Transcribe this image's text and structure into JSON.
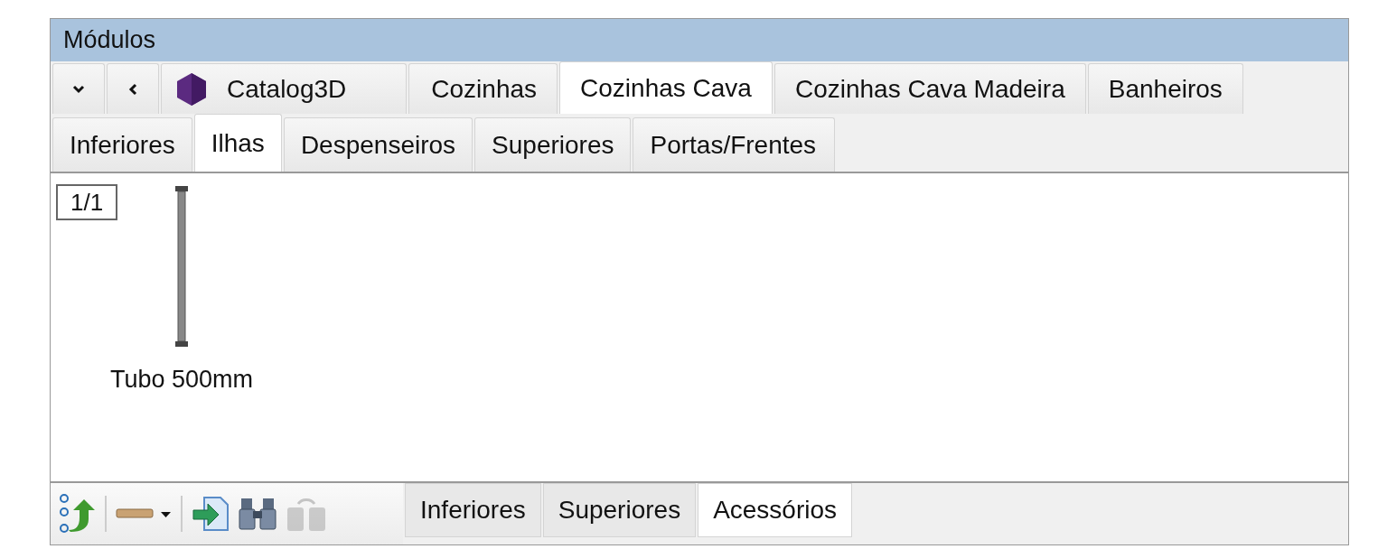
{
  "window": {
    "title": "Módulos"
  },
  "category_tabs": [
    {
      "label": "Catalog3D",
      "kind": "catalog",
      "selected": false
    },
    {
      "label": "Cozinhas",
      "selected": false
    },
    {
      "label": "Cozinhas Cava",
      "selected": true
    },
    {
      "label": "Cozinhas Cava Madeira",
      "selected": false
    },
    {
      "label": "Banheiros",
      "selected": false
    }
  ],
  "sub_tabs": [
    {
      "label": "Inferiores",
      "selected": false
    },
    {
      "label": "Ilhas",
      "selected": true
    },
    {
      "label": "Despenseiros",
      "selected": false
    },
    {
      "label": "Superiores",
      "selected": false
    },
    {
      "label": "Portas/Frentes",
      "selected": false
    }
  ],
  "page_indicator": "1/1",
  "items": [
    {
      "label": "Tubo 500mm"
    }
  ],
  "toolbar_buttons": [
    {
      "kind": "tree",
      "disabled": false
    },
    {
      "kind": "separator"
    },
    {
      "kind": "material",
      "disabled": false
    },
    {
      "kind": "separator"
    },
    {
      "kind": "import",
      "disabled": false
    },
    {
      "kind": "find",
      "disabled": false
    },
    {
      "kind": "lock",
      "disabled": true
    }
  ],
  "bottom_tabs": [
    {
      "label": "Inferiores",
      "selected": false
    },
    {
      "label": "Superiores",
      "selected": false
    },
    {
      "label": "Acessórios",
      "selected": true
    }
  ]
}
